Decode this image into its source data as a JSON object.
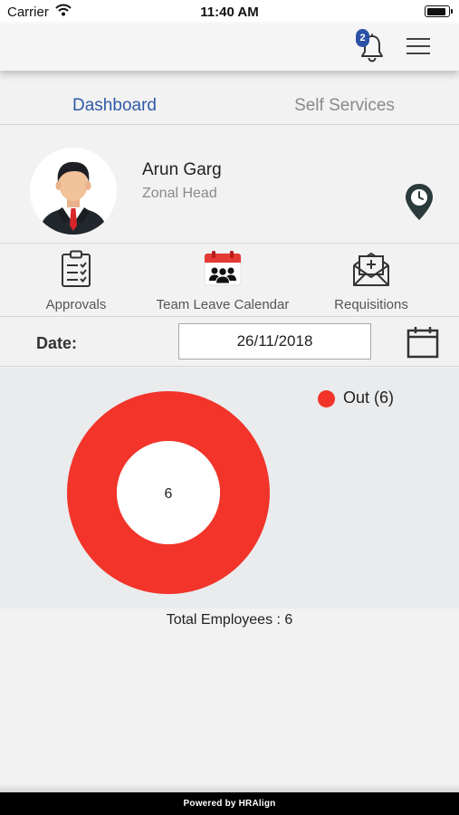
{
  "status_bar": {
    "carrier": "Carrier",
    "time": "11:40 AM"
  },
  "header": {
    "notification_count": "2",
    "icons": [
      "bell-icon",
      "menu-icon"
    ]
  },
  "tabs": [
    {
      "label": "Dashboard",
      "active": true
    },
    {
      "label": "Self Services",
      "active": false
    }
  ],
  "profile": {
    "name": "Arun Garg",
    "role": "Zonal Head",
    "icons": [
      "avatar",
      "location-pin-icon"
    ]
  },
  "quick_actions": [
    {
      "label": "Approvals",
      "icon": "clipboard-checklist-icon"
    },
    {
      "label": "Team Leave Calendar",
      "icon": "team-calendar-icon"
    },
    {
      "label": "Requisitions",
      "icon": "envelope-add-icon"
    }
  ],
  "date_filter": {
    "label": "Date:",
    "value": "26/11/2018",
    "icon": "calendar-icon"
  },
  "chart_data": {
    "type": "pie",
    "subtype": "donut",
    "categories": [
      "Out"
    ],
    "values": [
      6
    ],
    "legend": [
      "Out (6)"
    ],
    "legend_position": "top-right",
    "center_label": "6",
    "colors": [
      "#f2342a"
    ]
  },
  "summary": {
    "total_label": "Total Employees : 6"
  },
  "footer": {
    "text": "Powered by HRAlign"
  },
  "colors": {
    "accent_blue": "#2f5aa8",
    "badge_blue": "#2c52a7",
    "chart_red": "#f2342a",
    "calendar_red": "#e53935"
  }
}
